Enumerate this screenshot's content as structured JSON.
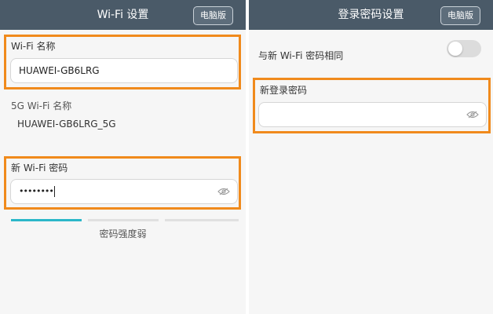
{
  "left": {
    "title": "Wi-Fi 设置",
    "pc_button": "电脑版",
    "wifi_name_label": "Wi-Fi 名称",
    "wifi_name_value": "HUAWEI-GB6LRG",
    "wifi5g_label": "5G Wi-Fi 名称",
    "wifi5g_value": "HUAWEI-GB6LRG_5G",
    "new_password_label": "新 Wi-Fi 密码",
    "new_password_masked": "••••••••",
    "strength_text": "密码强度弱",
    "strength_level": 0.33
  },
  "right": {
    "title": "登录密码设置",
    "pc_button": "电脑版",
    "same_as_wifi_label": "与新 Wi-Fi 密码相同",
    "same_as_wifi_enabled": false,
    "new_login_password_label": "新登录密码",
    "new_login_password_value": ""
  },
  "colors": {
    "titlebar": "#4a5a68",
    "highlight": "#f08a1c",
    "strength_active": "#2bb7c9",
    "strength_inactive": "#e0e0e0"
  },
  "icons": {
    "password_visibility": "eye-off-icon"
  }
}
